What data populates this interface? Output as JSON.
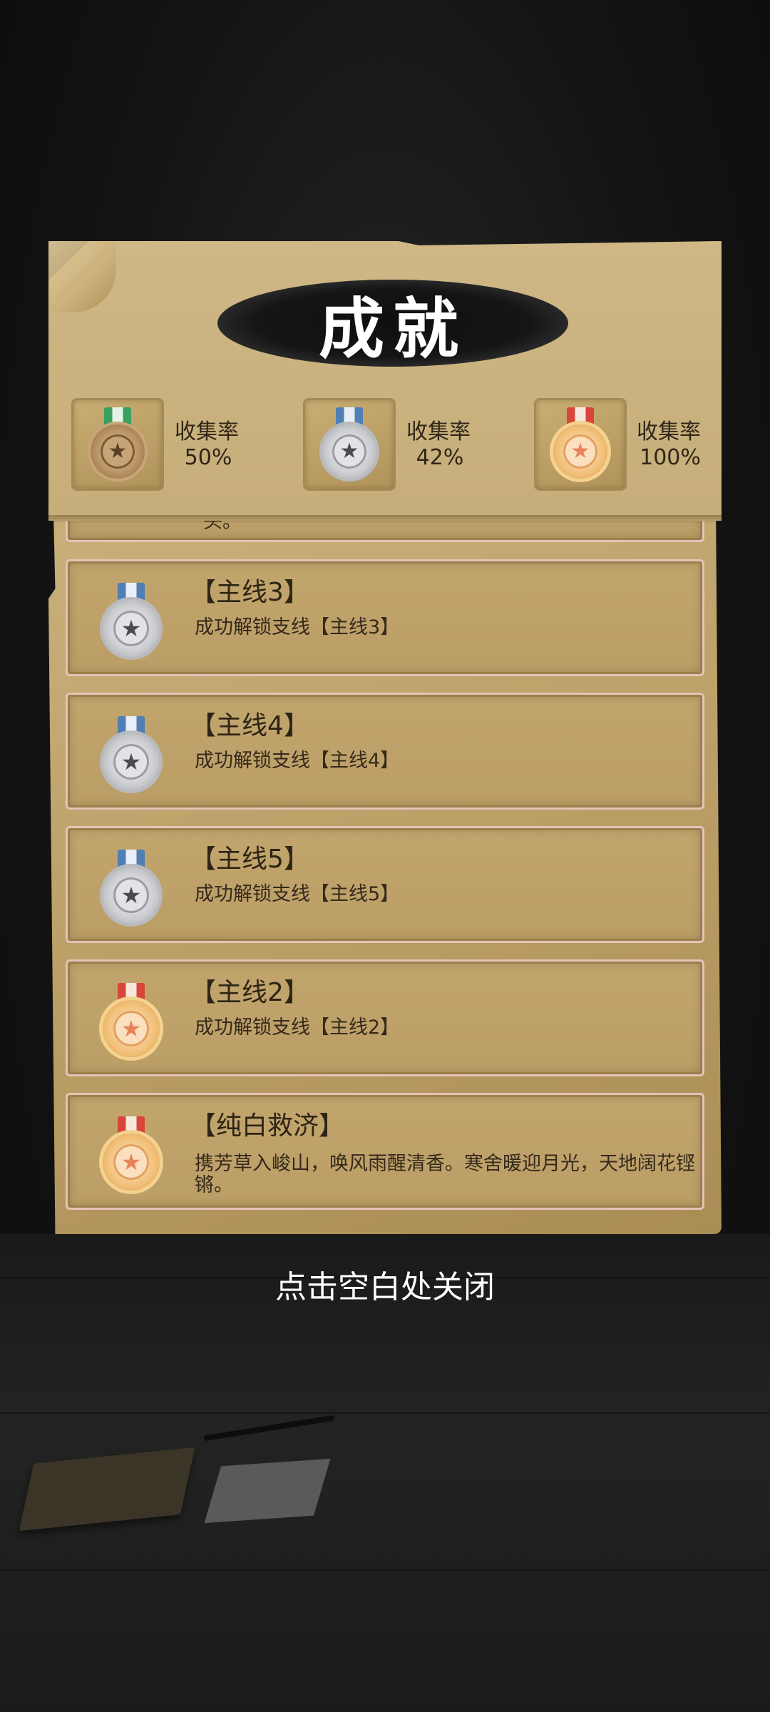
{
  "title": "成就",
  "stats": [
    {
      "label": "收集率",
      "value": "50%",
      "medal": "bronze-medal-icon"
    },
    {
      "label": "收集率",
      "value": "42%",
      "medal": "silver-medal-icon"
    },
    {
      "label": "收集率",
      "value": "100%",
      "medal": "gold-medal-icon"
    }
  ],
  "partial_card": {
    "desc_fragment": "头。"
  },
  "achievements": [
    {
      "title": "【主线3】",
      "desc": "成功解锁支线【主线3】",
      "medal": "silver-medal-icon"
    },
    {
      "title": "【主线4】",
      "desc": "成功解锁支线【主线4】",
      "medal": "silver-medal-icon"
    },
    {
      "title": "【主线5】",
      "desc": "成功解锁支线【主线5】",
      "medal": "silver-medal-icon"
    },
    {
      "title": "【主线2】",
      "desc": "成功解锁支线【主线2】",
      "medal": "gold-medal-icon"
    },
    {
      "title": "【纯白救济】",
      "desc": "携芳草入峻山，唤风雨醒清香。寒舍暖迎月光，天地阔花铿锵。",
      "medal": "gold-medal-icon"
    }
  ],
  "close_hint": "点击空白处关闭",
  "colors": {
    "bronze": "#b08a5a",
    "silver": "#c8c9cc",
    "gold": "#f2c07a",
    "ribbon_green": "#3aa060",
    "ribbon_blue": "#4f7fb5",
    "ribbon_red": "#d9453a"
  }
}
